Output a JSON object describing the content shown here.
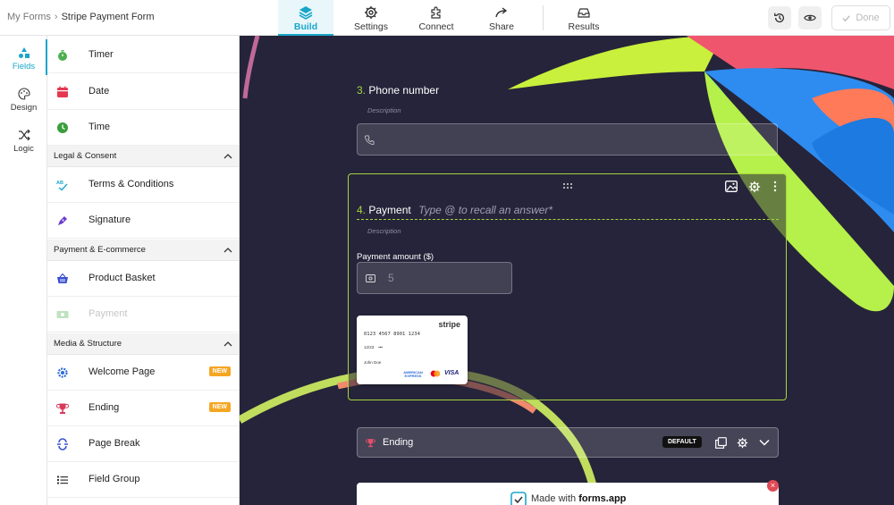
{
  "breadcrumb": {
    "parent": "My Forms",
    "separator": "›",
    "current": "Stripe Payment Form"
  },
  "nav_tabs": [
    {
      "label": "Build",
      "icon": "layers-icon"
    },
    {
      "label": "Settings",
      "icon": "gear-icon"
    },
    {
      "label": "Connect",
      "icon": "puzzle-icon"
    },
    {
      "label": "Share",
      "icon": "share-arrow-icon"
    },
    {
      "label": "Results",
      "icon": "inbox-icon"
    }
  ],
  "toolbar": {
    "done_label": "Done",
    "accent": "#19a6c9"
  },
  "rail": [
    {
      "label": "Fields",
      "icon": "shapes-icon"
    },
    {
      "label": "Design",
      "icon": "palette-icon"
    },
    {
      "label": "Logic",
      "icon": "shuffle-icon"
    }
  ],
  "fields": {
    "timer": "Timer",
    "date": "Date",
    "time": "Time",
    "section_legal": "Legal & Consent",
    "terms": "Terms & Conditions",
    "signature": "Signature",
    "section_payment": "Payment & E-commerce",
    "product_basket": "Product Basket",
    "payment": "Payment",
    "section_media": "Media & Structure",
    "welcome_page": "Welcome Page",
    "ending": "Ending",
    "page_break": "Page Break",
    "field_group": "Field Group",
    "new_badge": "NEW"
  },
  "form": {
    "phone": {
      "number": "3.",
      "title": "Phone number",
      "description": "Description"
    },
    "payment": {
      "number": "4.",
      "title": "Payment",
      "placeholder": "Type @ to recall an answer*",
      "description": "Description",
      "amount_label": "Payment amount ($)",
      "amount_value": "5",
      "card": {
        "brand": "stripe",
        "number": "0123 4567 8901 1234",
        "expiry": "12/23",
        "cvc": "•••",
        "name": "John Doe",
        "amex": "AMERICAN EXPRESS",
        "visa": "VISA"
      }
    },
    "ending": {
      "label": "Ending",
      "badge": "DEFAULT"
    },
    "made_with": {
      "prefix": "Made with",
      "brand": "forms.app"
    }
  }
}
